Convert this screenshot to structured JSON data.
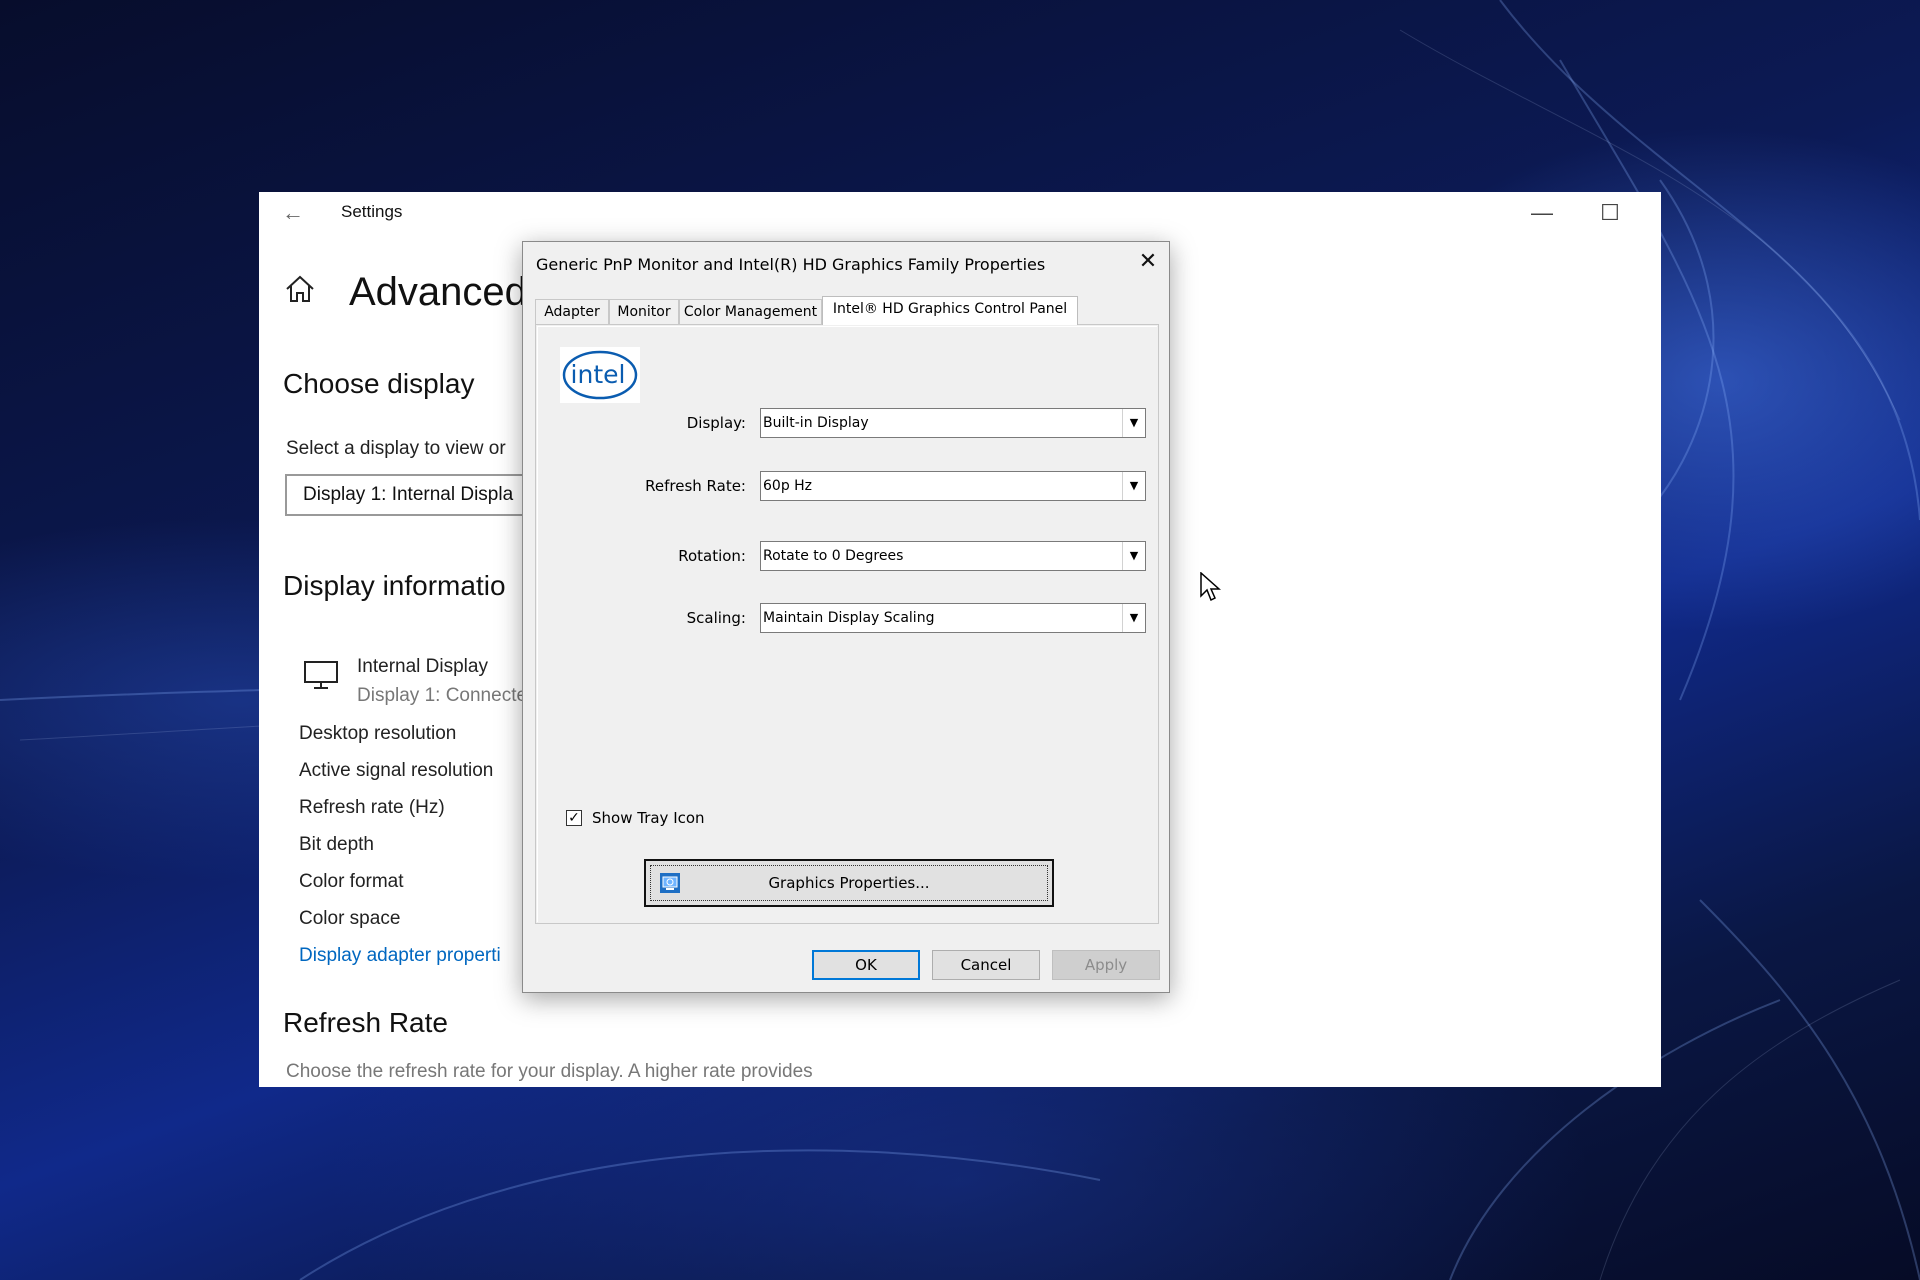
{
  "settings": {
    "title": "Settings",
    "heading": "Advanced",
    "choose_display": {
      "title": "Choose display",
      "desc": "Select a display to view or",
      "selected_value": "Display 1: Internal Displa"
    },
    "display_info": {
      "title": "Display informatio",
      "device_name": "Internal Display",
      "device_sub": "Display 1: Connecte",
      "rows": [
        "Desktop resolution",
        "Active signal resolution",
        "Refresh rate (Hz)",
        "Bit depth",
        "Color format",
        "Color space"
      ],
      "adapter_link": "Display adapter properti"
    },
    "refresh_rate": {
      "title": "Refresh Rate",
      "desc": "Choose the refresh rate for your display. A higher rate provides"
    }
  },
  "dialog": {
    "title": "Generic PnP Monitor and Intel(R) HD Graphics Family Properties",
    "tabs": [
      "Adapter",
      "Monitor",
      "Color Management",
      "Intel® HD Graphics Control Panel"
    ],
    "active_tab": 3,
    "logo_text": "intel",
    "fields": {
      "display": {
        "label": "Display:",
        "value": "Built-in Display"
      },
      "refresh": {
        "label": "Refresh Rate:",
        "value": "60p Hz"
      },
      "rotation": {
        "label": "Rotation:",
        "value": "Rotate to 0 Degrees"
      },
      "scaling": {
        "label": "Scaling:",
        "value": "Maintain Display Scaling"
      }
    },
    "tray": {
      "label": "Show Tray Icon",
      "checked": true
    },
    "graphics_button": "Graphics Properties...",
    "buttons": {
      "ok": "OK",
      "cancel": "Cancel",
      "apply": "Apply"
    }
  },
  "colors": {
    "accent": "#0078d7",
    "link": "#0067c0"
  }
}
